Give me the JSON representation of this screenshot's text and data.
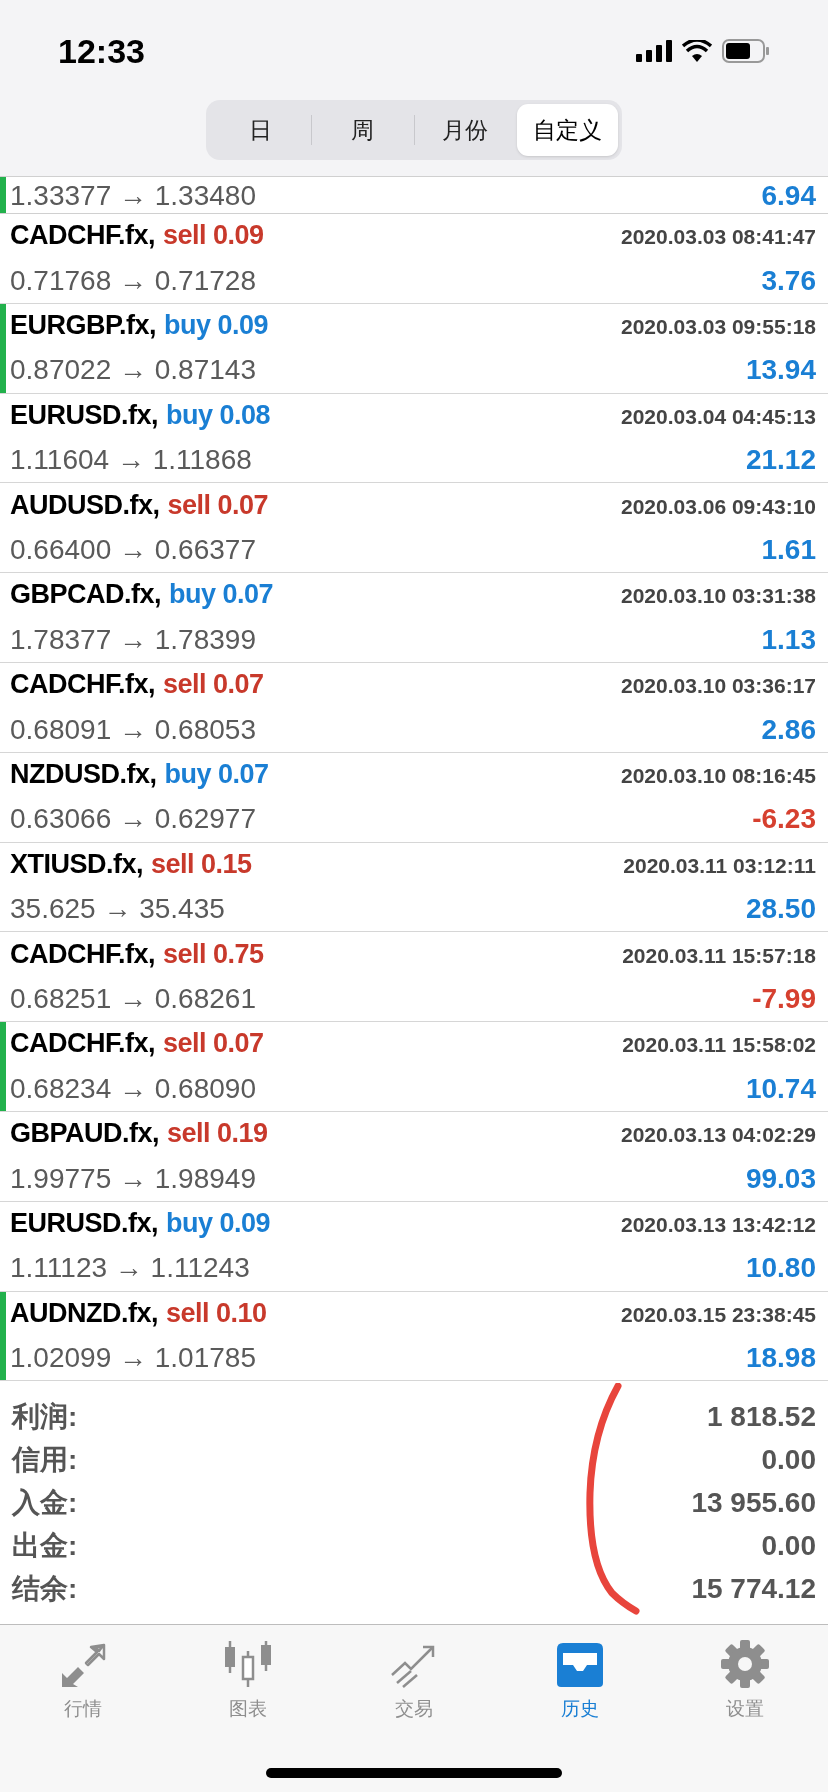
{
  "status_bar": {
    "time": "12:33"
  },
  "period_tabs": [
    {
      "label": "日",
      "selected": false
    },
    {
      "label": "周",
      "selected": false
    },
    {
      "label": "月份",
      "selected": false
    },
    {
      "label": "自定义",
      "selected": true
    }
  ],
  "partial_row": {
    "prices": "1.33377 → 1.33480",
    "profit": "6.94",
    "loss": false,
    "flagged": true
  },
  "trades": [
    {
      "symbol": "CADCHF.fx,",
      "kind": "sell",
      "order": "sell 0.09",
      "time": "2020.03.03 08:41:47",
      "prices": "0.71768 → 0.71728",
      "profit": "3.76",
      "loss": false,
      "flagged": false
    },
    {
      "symbol": "EURGBP.fx,",
      "kind": "buy",
      "order": "buy 0.09",
      "time": "2020.03.03 09:55:18",
      "prices": "0.87022 → 0.87143",
      "profit": "13.94",
      "loss": false,
      "flagged": true
    },
    {
      "symbol": "EURUSD.fx,",
      "kind": "buy",
      "order": "buy 0.08",
      "time": "2020.03.04 04:45:13",
      "prices": "1.11604 → 1.11868",
      "profit": "21.12",
      "loss": false,
      "flagged": false
    },
    {
      "symbol": "AUDUSD.fx,",
      "kind": "sell",
      "order": "sell 0.07",
      "time": "2020.03.06 09:43:10",
      "prices": "0.66400 → 0.66377",
      "profit": "1.61",
      "loss": false,
      "flagged": false
    },
    {
      "symbol": "GBPCAD.fx,",
      "kind": "buy",
      "order": "buy 0.07",
      "time": "2020.03.10 03:31:38",
      "prices": "1.78377 → 1.78399",
      "profit": "1.13",
      "loss": false,
      "flagged": false
    },
    {
      "symbol": "CADCHF.fx,",
      "kind": "sell",
      "order": "sell 0.07",
      "time": "2020.03.10 03:36:17",
      "prices": "0.68091 → 0.68053",
      "profit": "2.86",
      "loss": false,
      "flagged": false
    },
    {
      "symbol": "NZDUSD.fx,",
      "kind": "buy",
      "order": "buy 0.07",
      "time": "2020.03.10 08:16:45",
      "prices": "0.63066 → 0.62977",
      "profit": "-6.23",
      "loss": true,
      "flagged": false
    },
    {
      "symbol": "XTIUSD.fx,",
      "kind": "sell",
      "order": "sell 0.15",
      "time": "2020.03.11 03:12:11",
      "prices": "35.625 → 35.435",
      "profit": "28.50",
      "loss": false,
      "flagged": false
    },
    {
      "symbol": "CADCHF.fx,",
      "kind": "sell",
      "order": "sell 0.75",
      "time": "2020.03.11 15:57:18",
      "prices": "0.68251 → 0.68261",
      "profit": "-7.99",
      "loss": true,
      "flagged": false
    },
    {
      "symbol": "CADCHF.fx,",
      "kind": "sell",
      "order": "sell 0.07",
      "time": "2020.03.11 15:58:02",
      "prices": "0.68234 → 0.68090",
      "profit": "10.74",
      "loss": false,
      "flagged": true
    },
    {
      "symbol": "GBPAUD.fx,",
      "kind": "sell",
      "order": "sell 0.19",
      "time": "2020.03.13 04:02:29",
      "prices": "1.99775 → 1.98949",
      "profit": "99.03",
      "loss": false,
      "flagged": false
    },
    {
      "symbol": "EURUSD.fx,",
      "kind": "buy",
      "order": "buy 0.09",
      "time": "2020.03.13 13:42:12",
      "prices": "1.11123 → 1.11243",
      "profit": "10.80",
      "loss": false,
      "flagged": false
    },
    {
      "symbol": "AUDNZD.fx,",
      "kind": "sell",
      "order": "sell 0.10",
      "time": "2020.03.15 23:38:45",
      "prices": "1.02099 → 1.01785",
      "profit": "18.98",
      "loss": false,
      "flagged": true
    }
  ],
  "summary": [
    {
      "label": "利润:",
      "value": "1 818.52"
    },
    {
      "label": "信用:",
      "value": "0.00"
    },
    {
      "label": "入金:",
      "value": "13 955.60"
    },
    {
      "label": "出金:",
      "value": "0.00"
    },
    {
      "label": "结余:",
      "value": "15 774.12"
    }
  ],
  "bottom_tabs": [
    {
      "kind": "quotes",
      "label": "行情",
      "selected": false
    },
    {
      "kind": "chart",
      "label": "图表",
      "selected": false
    },
    {
      "kind": "trade",
      "label": "交易",
      "selected": false
    },
    {
      "kind": "history",
      "label": "历史",
      "selected": true
    },
    {
      "kind": "settings",
      "label": "设置",
      "selected": false
    }
  ]
}
